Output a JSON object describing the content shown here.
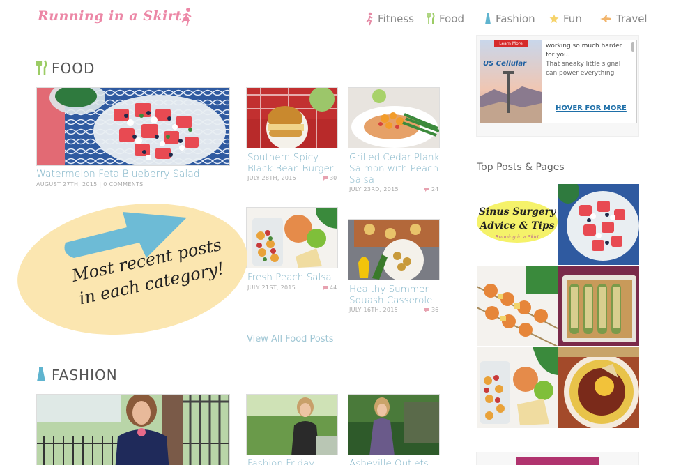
{
  "site": {
    "logo_text": "Running in a Skirt",
    "accent_color": "#7fb3c7",
    "logo_color": "#ec87a6"
  },
  "nav": {
    "items": [
      {
        "label": "Fitness",
        "icon": "runner-icon"
      },
      {
        "label": "Food",
        "icon": "fork-knife-icon"
      },
      {
        "label": "Fashion",
        "icon": "dress-icon"
      },
      {
        "label": "Fun",
        "icon": "star-icon"
      },
      {
        "label": "Travel",
        "icon": "plane-icon"
      }
    ]
  },
  "food": {
    "title": "FOOD",
    "featured": {
      "title": "Watermelon Feta Blueberry Salad",
      "date": "AUGUST 27TH, 2015",
      "comments": "0 COMMENTS"
    },
    "posts": [
      {
        "title": "Southern Spicy Black Bean Burger",
        "date": "JULY 28TH, 2015",
        "comments": "30"
      },
      {
        "title": "Grilled Cedar Plank Salmon with Peach Salsa",
        "date": "JULY 23RD, 2015",
        "comments": "24"
      },
      {
        "title": "Fresh Peach Salsa",
        "date": "JULY 21ST, 2015",
        "comments": "44"
      },
      {
        "title": "Healthy Summer Squash Casserole",
        "date": "JULY 16TH, 2015",
        "comments": "36"
      }
    ],
    "view_all": "View All Food Posts"
  },
  "annotation": {
    "text": "Most recent posts in each category!"
  },
  "fashion": {
    "title": "FASHION",
    "posts": [
      {
        "title": "Fashion Friday"
      },
      {
        "title": "Asheville Outlets"
      }
    ]
  },
  "sidebar": {
    "ad": {
      "learn_more": "Learn More",
      "brand": "US Cellular",
      "text1": "working so much harder for you.",
      "text2": "That sneaky little signal can power everything from your thermostat to your",
      "link": "HOVER FOR MORE"
    },
    "top_posts_title": "Top Posts & Pages",
    "sinus": {
      "line1": "Sinus Surgery",
      "line2": "Advice & Tips",
      "sub": "Running in a Skirt"
    }
  }
}
